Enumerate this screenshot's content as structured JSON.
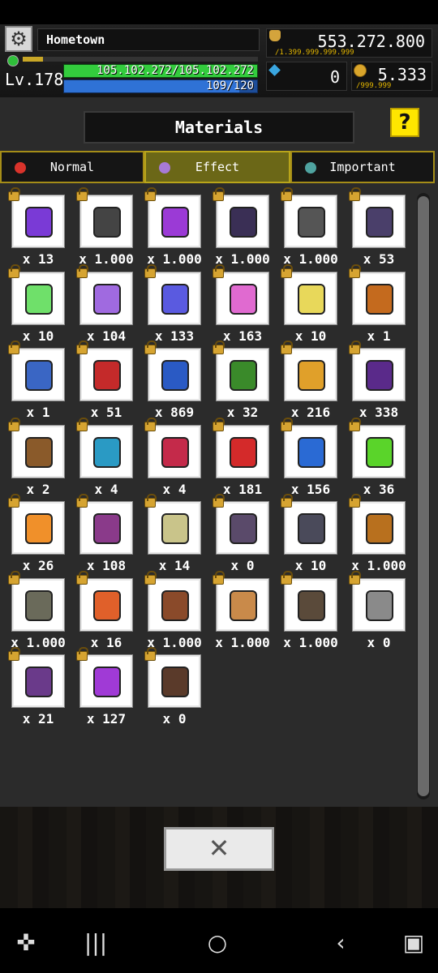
{
  "hud": {
    "location": "Hometown",
    "level": "Lv.178",
    "xp_fraction": 0.085,
    "hp_text": "105.102.272/105.102.272",
    "hp_fraction": 1.0,
    "mp_text": "109/120",
    "mp_fraction": 0.908,
    "gold": "553.272.800",
    "gold_cap": "/1.399.999.999.999",
    "gems": "0",
    "coins": "5.333",
    "coins_cap": "/999.999"
  },
  "panel": {
    "title": "Materials",
    "help": "?",
    "tabs": [
      {
        "label": "Normal",
        "icon": "red-orb-icon",
        "color": "#d9332b",
        "active": false
      },
      {
        "label": "Effect",
        "icon": "purple-potion-icon",
        "color": "#a77ad6",
        "active": true
      },
      {
        "label": "Important",
        "icon": "cube-icon",
        "color": "#4fa3a0",
        "active": false
      }
    ]
  },
  "items": [
    {
      "icon": "dark-cube-icon",
      "qty": "x 13",
      "color": "#7a3ad6"
    },
    {
      "icon": "dark-bag-icon",
      "qty": "x 1.000",
      "color": "#444"
    },
    {
      "icon": "dark-potion-icon",
      "qty": "x 1.000",
      "color": "#9b3ad6"
    },
    {
      "icon": "dark-book-icon",
      "qty": "x 1.000",
      "color": "#3a2f55"
    },
    {
      "icon": "dark-chalice-icon",
      "qty": "x 1.000",
      "color": "#555"
    },
    {
      "icon": "hourglass-icon",
      "qty": "x 53",
      "color": "#4a3f6a"
    },
    {
      "icon": "green-milk-icon",
      "qty": "x 10",
      "color": "#6fe06a"
    },
    {
      "icon": "purple-milk-icon",
      "qty": "x 104",
      "color": "#a06ae0"
    },
    {
      "icon": "blue-milk-icon",
      "qty": "x 133",
      "color": "#5a5ae0"
    },
    {
      "icon": "pink-milk-icon",
      "qty": "x 163",
      "color": "#e06ad0"
    },
    {
      "icon": "yellow-milk-icon",
      "qty": "x 10",
      "color": "#e8d85a"
    },
    {
      "icon": "lantern-icon",
      "qty": "x 1",
      "color": "#c46a1e"
    },
    {
      "icon": "scroll-icon",
      "qty": "x 1",
      "color": "#3a66c4"
    },
    {
      "icon": "red-tome-icon",
      "qty": "x 51",
      "color": "#c42a2a"
    },
    {
      "icon": "blue-tome-icon",
      "qty": "x 869",
      "color": "#2a5ac4"
    },
    {
      "icon": "green-tome-icon",
      "qty": "x 32",
      "color": "#3a8a2a"
    },
    {
      "icon": "gold-tome-icon",
      "qty": "x 216",
      "color": "#e0a02a"
    },
    {
      "icon": "purple-tome-icon",
      "qty": "x 338",
      "color": "#5a2a8a"
    },
    {
      "icon": "gem-box-icon",
      "qty": "x 2",
      "color": "#8a5a2a"
    },
    {
      "icon": "blue-cube-icon",
      "qty": "x 4",
      "color": "#2a9ac4"
    },
    {
      "icon": "red-cube-icon",
      "qty": "x 4",
      "color": "#c42a4a"
    },
    {
      "icon": "red-mushroom-icon",
      "qty": "x 181",
      "color": "#d42a2a"
    },
    {
      "icon": "blue-mushroom-icon",
      "qty": "x 156",
      "color": "#2a6ad4"
    },
    {
      "icon": "green-mushroom-icon",
      "qty": "x 36",
      "color": "#5ad42a"
    },
    {
      "icon": "orange-mushroom-icon",
      "qty": "x 26",
      "color": "#f0902a"
    },
    {
      "icon": "purple-mushroom-icon",
      "qty": "x 108",
      "color": "#8a3a8a"
    },
    {
      "icon": "bottle-icon",
      "qty": "x 14",
      "color": "#c9c48a"
    },
    {
      "icon": "gargoyle-icon",
      "qty": "x 0",
      "color": "#5a4a6a"
    },
    {
      "icon": "horned-helmet-icon",
      "qty": "x 10",
      "color": "#4a4a5a"
    },
    {
      "icon": "amulet-icon",
      "qty": "x 1.000",
      "color": "#b8701e"
    },
    {
      "icon": "dragon-medal-icon",
      "qty": "x 1.000",
      "color": "#6a6a5a"
    },
    {
      "icon": "brazier-icon",
      "qty": "x 16",
      "color": "#e0602a"
    },
    {
      "icon": "orb-device-icon",
      "qty": "x 1.000",
      "color": "#8a4a2a"
    },
    {
      "icon": "horn-icon",
      "qty": "x 1.000",
      "color": "#c98a4a"
    },
    {
      "icon": "knight-helmet-icon",
      "qty": "x 1.000",
      "color": "#5a4a3a"
    },
    {
      "icon": "bear-trap-icon",
      "qty": "x 0",
      "color": "#8a8a8a"
    },
    {
      "icon": "dark-ring-icon",
      "qty": "x 21",
      "color": "#6a3a8a"
    },
    {
      "icon": "quill-icon",
      "qty": "x 127",
      "color": "#a03ad6"
    },
    {
      "icon": "chest-icon",
      "qty": "x 0",
      "color": "#5a3a2a"
    }
  ],
  "close_button": "✕"
}
